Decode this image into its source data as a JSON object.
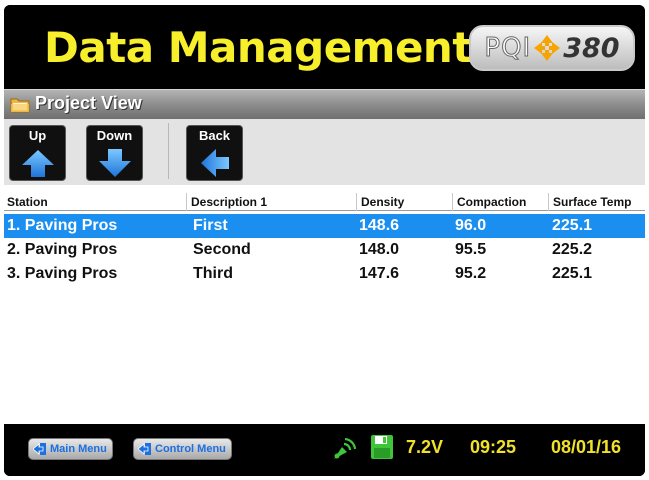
{
  "header": {
    "title": "Data Management",
    "logo": {
      "brand": "PQI",
      "model": "380"
    }
  },
  "view": {
    "title": "Project View"
  },
  "toolbar": {
    "up_label": "Up",
    "down_label": "Down",
    "back_label": "Back"
  },
  "table": {
    "columns": [
      "Station",
      "Description 1",
      "Density",
      "Compaction",
      "Surface Temp"
    ],
    "rows": [
      {
        "station": "1. Paving Pros",
        "description": "First",
        "density": "148.6",
        "compaction": "96.0",
        "surface_temp": "225.1",
        "selected": true
      },
      {
        "station": "2. Paving Pros",
        "description": "Second",
        "density": "148.0",
        "compaction": "95.5",
        "surface_temp": "225.2",
        "selected": false
      },
      {
        "station": "3. Paving Pros",
        "description": "Third",
        "density": "147.6",
        "compaction": "95.2",
        "surface_temp": "225.1",
        "selected": false
      }
    ]
  },
  "footer": {
    "main_menu_label": "Main Menu",
    "control_menu_label": "Control Menu",
    "voltage": "7.2V",
    "time": "09:25",
    "date": "08/01/16"
  },
  "colors": {
    "title_yellow": "#f7ee2c",
    "selection_blue": "#1a8ff0",
    "status_yellow": "#f2e12a"
  },
  "icons": [
    "folder-icon",
    "up-arrow-icon",
    "down-arrow-icon",
    "back-arrow-icon",
    "menu-arrow-icon",
    "gps-signal-icon",
    "save-disk-icon"
  ]
}
